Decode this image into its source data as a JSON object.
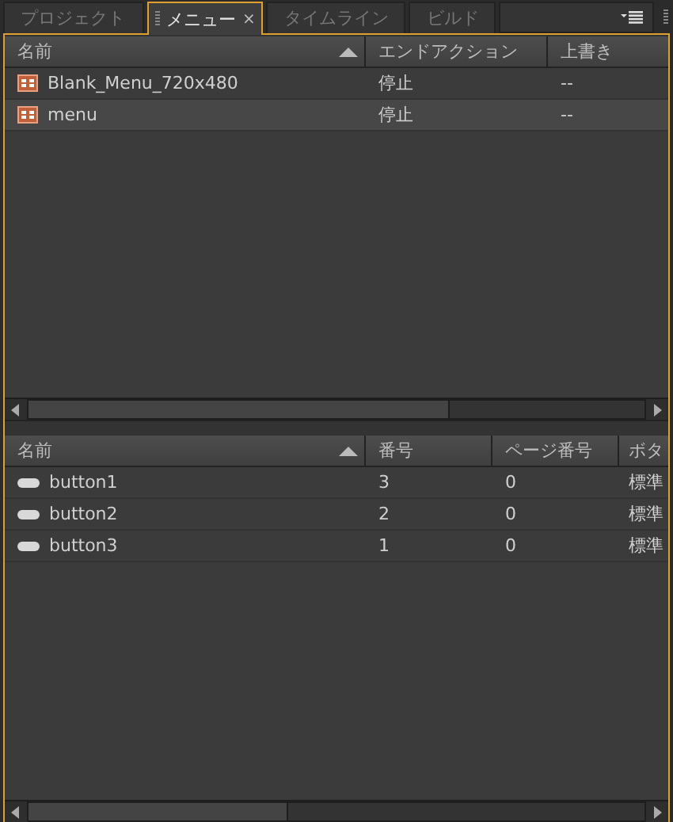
{
  "tabs": [
    {
      "label": "プロジェクト",
      "selected": false,
      "closable": false
    },
    {
      "label": "メニュー",
      "selected": true,
      "closable": true,
      "close_glyph": "×"
    },
    {
      "label": "タイムライン",
      "selected": false,
      "closable": false
    },
    {
      "label": "ビルド",
      "selected": false,
      "closable": false
    }
  ],
  "menus_table": {
    "columns": [
      "名前",
      "エンドアクション",
      "上書き"
    ],
    "rows": [
      {
        "name": "Blank_Menu_720x480",
        "end_action": "停止",
        "override": "--",
        "selected": false
      },
      {
        "name": "menu",
        "end_action": "停止",
        "override": "--",
        "selected": true
      }
    ]
  },
  "buttons_table": {
    "columns": [
      "名前",
      "番号",
      "ページ番号",
      "ボタ"
    ],
    "rows": [
      {
        "name": "button1",
        "number": "3",
        "page_number": "0",
        "column_4": "標準",
        "selected": false
      },
      {
        "name": "button2",
        "number": "2",
        "page_number": "0",
        "column_4": "標準",
        "selected": false
      },
      {
        "name": "button3",
        "number": "1",
        "page_number": "0",
        "column_4": "標準",
        "selected": false
      }
    ]
  }
}
